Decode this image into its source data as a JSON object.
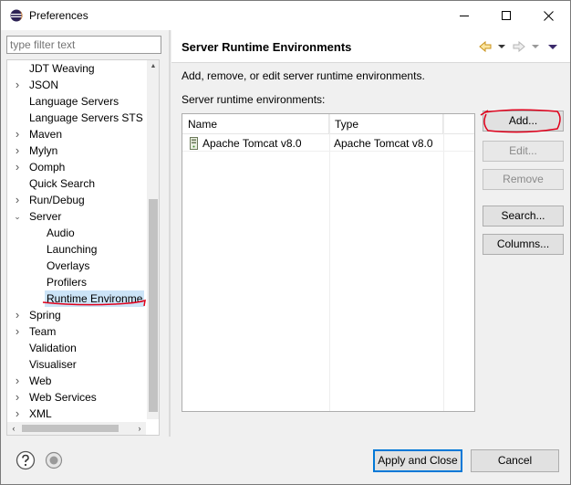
{
  "window": {
    "title": "Preferences",
    "minimize_glyph": "—",
    "maximize_glyph": "☐",
    "close_glyph": "✕"
  },
  "filter": {
    "placeholder": "type filter text"
  },
  "tree": {
    "items": [
      {
        "label": "JDT Weaving",
        "level": 0,
        "expandable": false,
        "expanded": false,
        "selected": false
      },
      {
        "label": "JSON",
        "level": 0,
        "expandable": true,
        "expanded": false,
        "selected": false
      },
      {
        "label": "Language Servers",
        "level": 0,
        "expandable": false,
        "expanded": false,
        "selected": false
      },
      {
        "label": "Language Servers STS",
        "level": 0,
        "expandable": false,
        "expanded": false,
        "selected": false
      },
      {
        "label": "Maven",
        "level": 0,
        "expandable": true,
        "expanded": false,
        "selected": false
      },
      {
        "label": "Mylyn",
        "level": 0,
        "expandable": true,
        "expanded": false,
        "selected": false
      },
      {
        "label": "Oomph",
        "level": 0,
        "expandable": true,
        "expanded": false,
        "selected": false
      },
      {
        "label": "Quick Search",
        "level": 0,
        "expandable": false,
        "expanded": false,
        "selected": false
      },
      {
        "label": "Run/Debug",
        "level": 0,
        "expandable": true,
        "expanded": false,
        "selected": false
      },
      {
        "label": "Server",
        "level": 0,
        "expandable": true,
        "expanded": true,
        "selected": false
      },
      {
        "label": "Audio",
        "level": 1,
        "expandable": false,
        "expanded": false,
        "selected": false
      },
      {
        "label": "Launching",
        "level": 1,
        "expandable": false,
        "expanded": false,
        "selected": false
      },
      {
        "label": "Overlays",
        "level": 1,
        "expandable": false,
        "expanded": false,
        "selected": false
      },
      {
        "label": "Profilers",
        "level": 1,
        "expandable": false,
        "expanded": false,
        "selected": false
      },
      {
        "label": "Runtime Environme",
        "level": 1,
        "expandable": false,
        "expanded": false,
        "selected": true
      },
      {
        "label": "Spring",
        "level": 0,
        "expandable": true,
        "expanded": false,
        "selected": false
      },
      {
        "label": "Team",
        "level": 0,
        "expandable": true,
        "expanded": false,
        "selected": false
      },
      {
        "label": "Validation",
        "level": 0,
        "expandable": false,
        "expanded": false,
        "selected": false
      },
      {
        "label": "Visualiser",
        "level": 0,
        "expandable": false,
        "expanded": false,
        "selected": false
      },
      {
        "label": "Web",
        "level": 0,
        "expandable": true,
        "expanded": false,
        "selected": false
      },
      {
        "label": "Web Services",
        "level": 0,
        "expandable": true,
        "expanded": false,
        "selected": false
      },
      {
        "label": "XML",
        "level": 0,
        "expandable": true,
        "expanded": false,
        "selected": false
      }
    ]
  },
  "page": {
    "title": "Server Runtime Environments",
    "description": "Add, remove, or edit server runtime environments.",
    "list_label": "Server runtime environments:",
    "table": {
      "columns": [
        "Name",
        "Type"
      ],
      "rows": [
        {
          "name": "Apache Tomcat v8.0",
          "type": "Apache Tomcat v8.0"
        }
      ]
    },
    "buttons": {
      "add": "Add...",
      "edit": "Edit...",
      "remove": "Remove",
      "search": "Search...",
      "columns": "Columns..."
    }
  },
  "footer": {
    "apply_close": "Apply and Close",
    "cancel": "Cancel"
  },
  "colors": {
    "accent": "#0078d7",
    "selection": "#cce4f7",
    "annotation": "#e0001b"
  }
}
